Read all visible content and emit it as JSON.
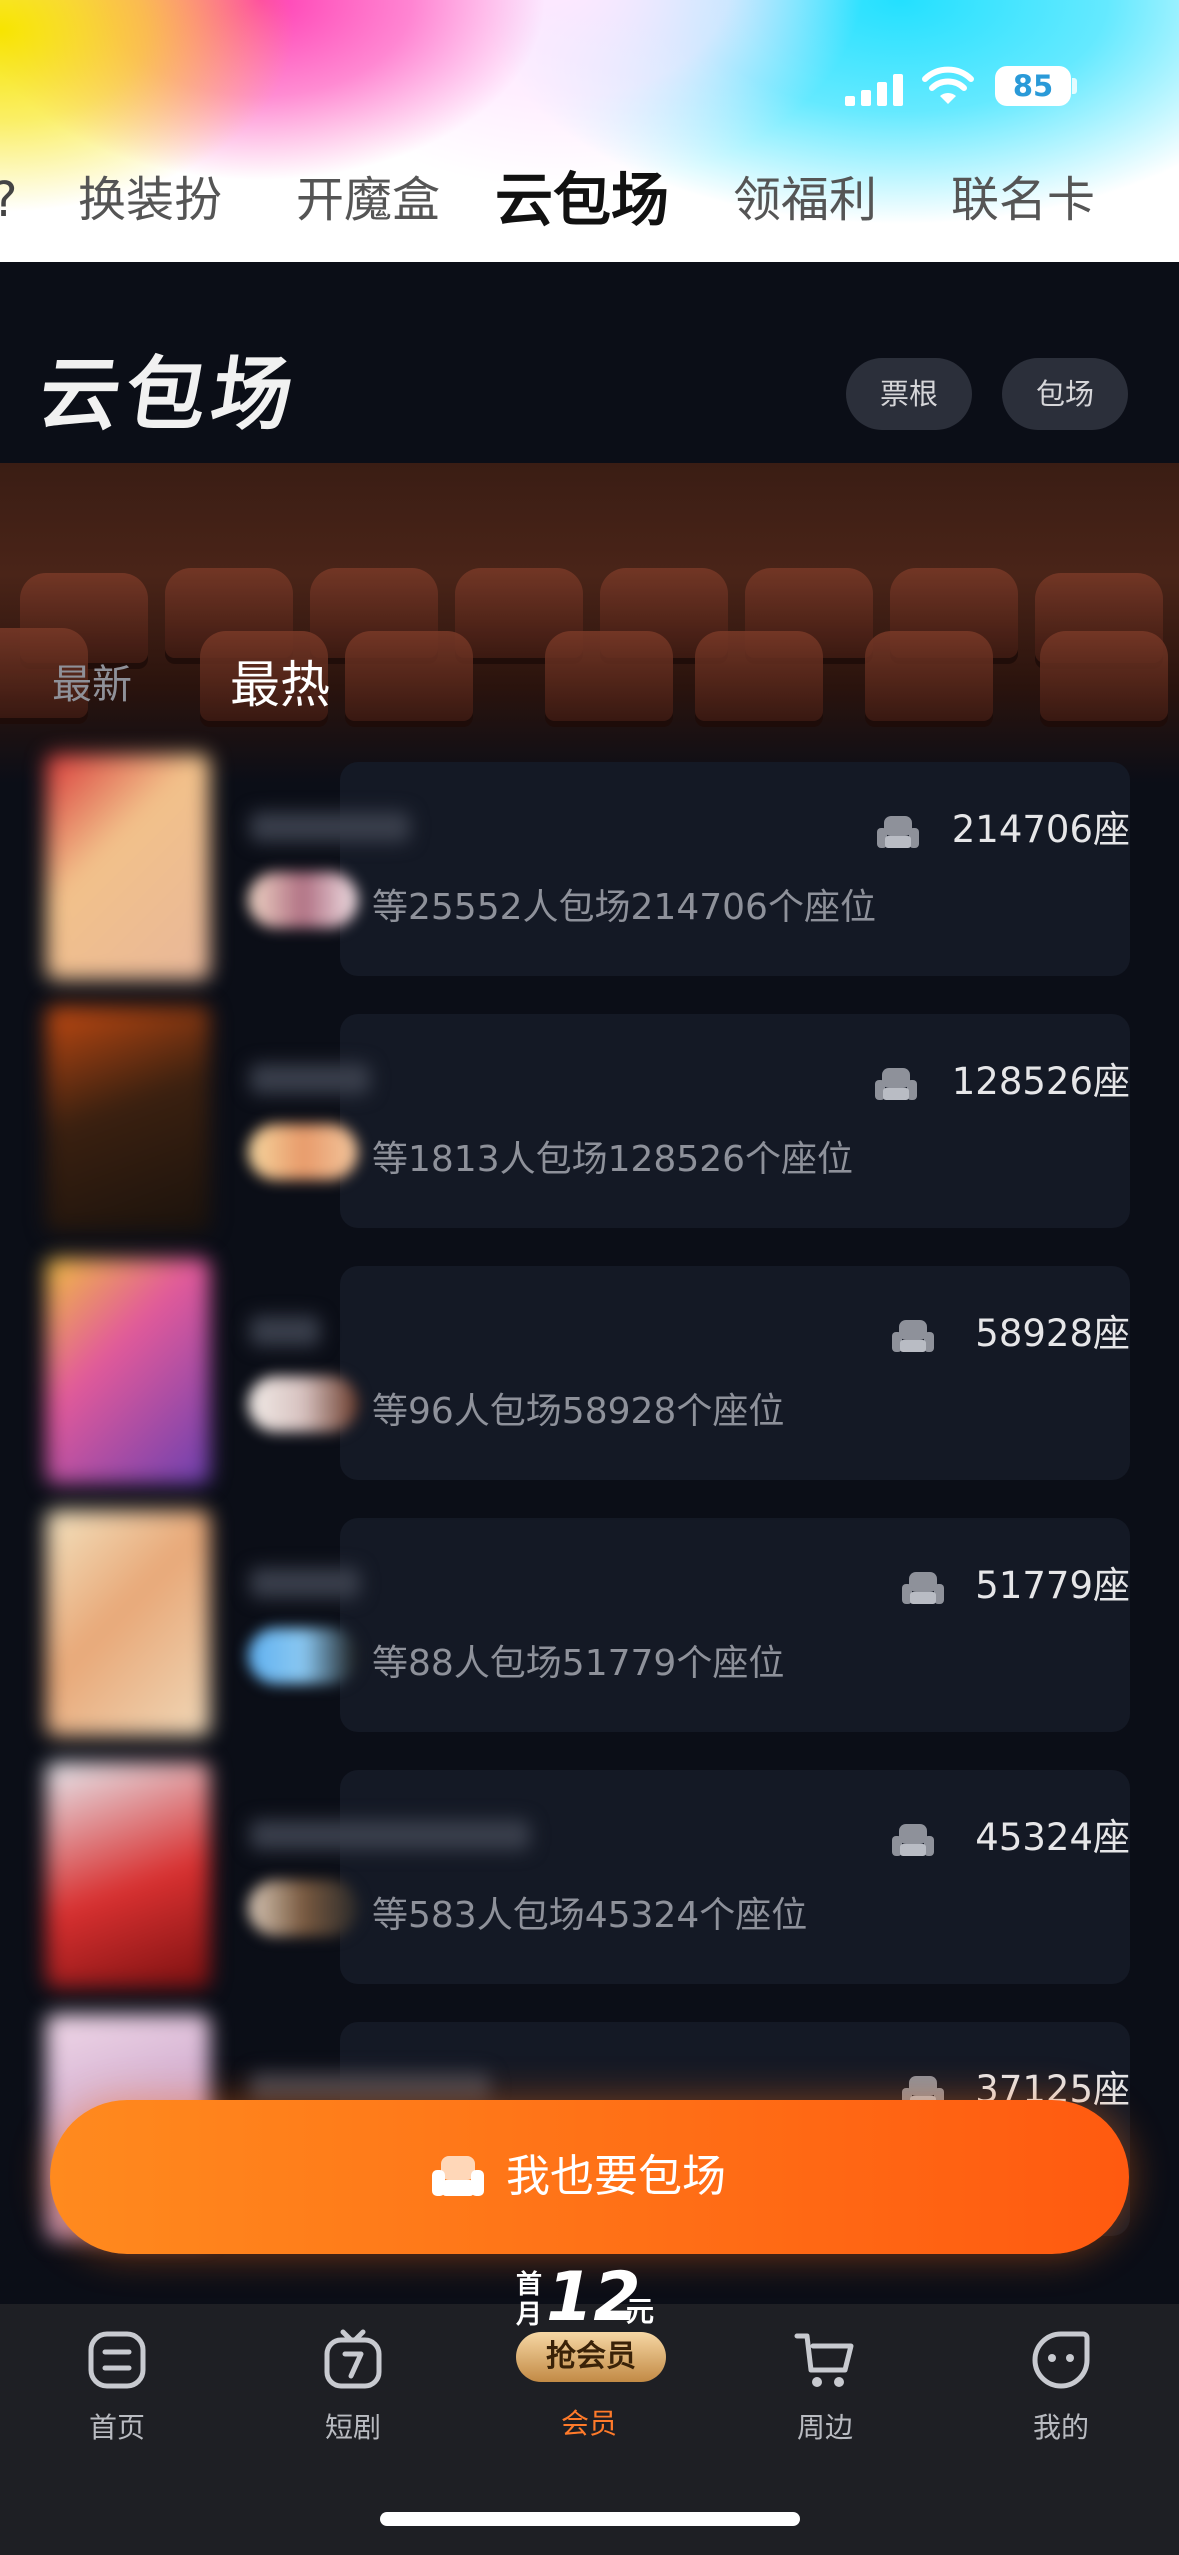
{
  "status_bar": {
    "battery": "85"
  },
  "top_tabs": [
    "换装扮",
    "开魔盒",
    "云包场",
    "领福利",
    "联名卡"
  ],
  "top_tabs_active": "云包场",
  "header": {
    "brand": "云包场",
    "buttons": [
      "票根",
      "包场"
    ]
  },
  "sort_tabs": {
    "latest": "最新",
    "hottest": "最热",
    "active": "最热"
  },
  "list": [
    {
      "seats": "214706座",
      "desc": "等25552人包场214706个座位"
    },
    {
      "seats": "128526座",
      "desc": "等1813人包场128526个座位"
    },
    {
      "seats": "58928座",
      "desc": "等96人包场58928个座位"
    },
    {
      "seats": "51779座",
      "desc": "等88人包场51779个座位"
    },
    {
      "seats": "45324座",
      "desc": "等583人包场45324个座位"
    },
    {
      "seats": "37125座",
      "desc": ""
    }
  ],
  "cta": {
    "label": "我也要包场"
  },
  "promo": {
    "line1": "首",
    "line2": "月",
    "price": "12",
    "unit": "元",
    "badge": "抢会员"
  },
  "bottom_nav": [
    {
      "label": "首页",
      "icon": "home-icon"
    },
    {
      "label": "短剧",
      "icon": "tv-icon"
    },
    {
      "label": "会员",
      "icon": "vip-icon"
    },
    {
      "label": "周边",
      "icon": "cart-icon"
    },
    {
      "label": "我的",
      "icon": "profile-icon"
    }
  ],
  "bottom_nav_active": "会员",
  "colors": {
    "accent": "#ff6a14",
    "card": "#141925",
    "background": "#0b0e17"
  }
}
